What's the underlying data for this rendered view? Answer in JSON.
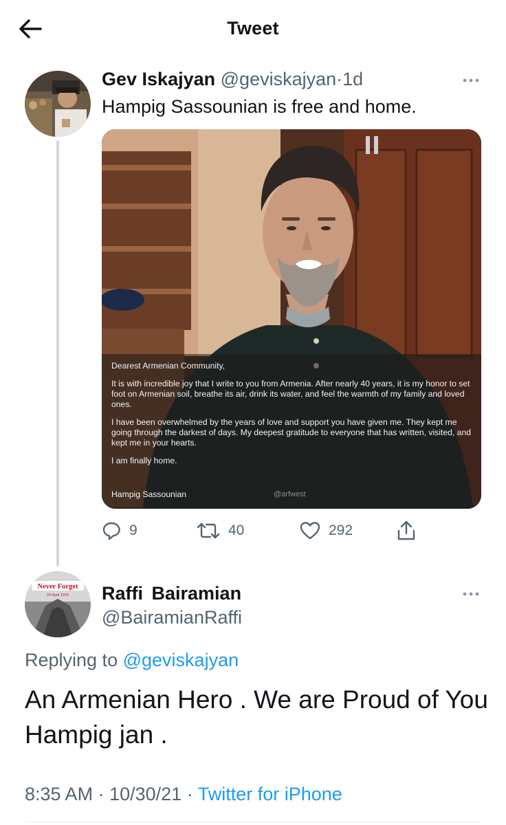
{
  "header": {
    "title": "Tweet",
    "back_icon": "arrow-left-icon"
  },
  "tweet": {
    "author_name": "Gev Iskajyan",
    "author_handle": "@geviskajyan",
    "separator": "·",
    "time_ago": "1d",
    "text": "Hampig Sassounian is free and home.",
    "image_letter": {
      "greeting": "Dearest Armenian Community,",
      "paragraph1": "It is with incredible joy that I write to you from Armenia. After nearly 40 years, it is my honor to set foot on Armenian soil, breathe its air, drink its water, and feel the warmth of my family and loved ones.",
      "paragraph2": "I have been overwhelmed by the years of love and support you have given me. They kept me going through the darkest of days. My deepest gratitude to everyone that has written, visited, and kept me in your hearts.",
      "closing": "I am finally home.",
      "signature": "Hampig Sassounian",
      "watermark": "@arfwest"
    },
    "replies": "9",
    "retweets": "40",
    "likes": "292"
  },
  "reply": {
    "author_name": "Raffi Bairamian",
    "author_handle": "@BairamianRaffi",
    "replying_prefix": "Replying to",
    "replying_to": "@geviskajyan",
    "text": "An Armenian Hero . We are Proud of You Hampig jan .",
    "avatar_banner": "Never Forget",
    "avatar_subtext": "24 April 1915",
    "time": "8:35 AM",
    "date": "10/30/21",
    "source": "Twitter for iPhone"
  },
  "colors": {
    "accent": "#1d9bf0",
    "muted": "#536471",
    "text": "#0f1419",
    "divider": "#cfd9de"
  }
}
